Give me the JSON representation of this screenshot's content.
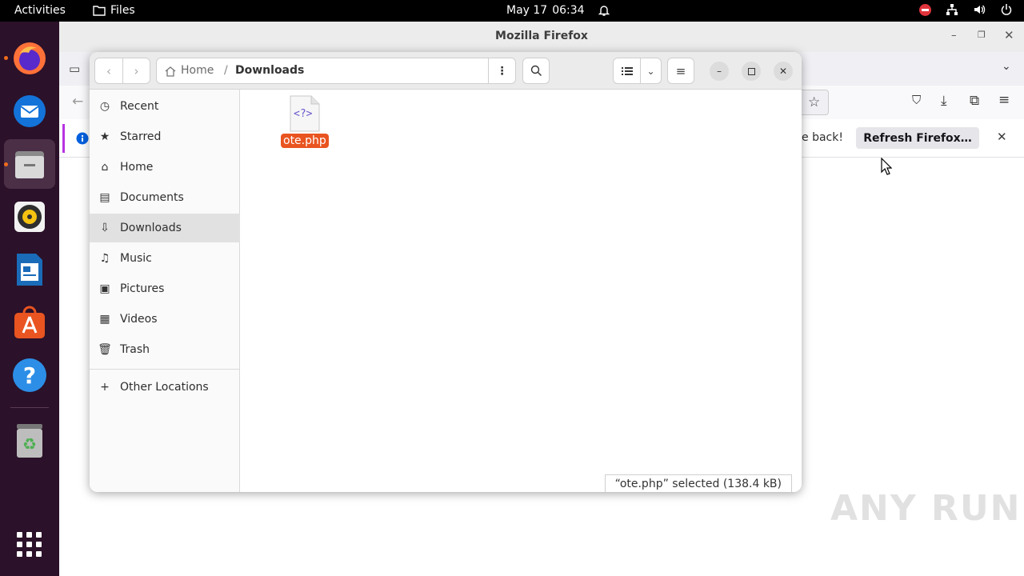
{
  "topbar": {
    "activities": "Activities",
    "app_name": "Files",
    "date": "May 17",
    "time": "06:34"
  },
  "dock": {
    "apps": [
      "firefox-icon",
      "thunderbird-icon",
      "files-icon",
      "rhythmbox-icon",
      "libreoffice-writer-icon",
      "app-center-icon",
      "help-icon",
      "trash-icon",
      "show-apps-icon"
    ]
  },
  "firefox": {
    "title": "Mozilla Firefox",
    "notice_text": "e back!",
    "refresh_button": "Refresh Firefox…"
  },
  "files": {
    "path_home": "Home",
    "path_separator": "/",
    "path_current": "Downloads",
    "sidebar": [
      {
        "label": "Recent",
        "icon": "clock-icon",
        "glyph": "◷"
      },
      {
        "label": "Starred",
        "icon": "star-icon",
        "glyph": "★"
      },
      {
        "label": "Home",
        "icon": "home-icon",
        "glyph": "⌂"
      },
      {
        "label": "Documents",
        "icon": "document-icon",
        "glyph": "▤"
      },
      {
        "label": "Downloads",
        "icon": "download-icon",
        "glyph": "⇩"
      },
      {
        "label": "Music",
        "icon": "music-icon",
        "glyph": "♫"
      },
      {
        "label": "Pictures",
        "icon": "pictures-icon",
        "glyph": "▣"
      },
      {
        "label": "Videos",
        "icon": "videos-icon",
        "glyph": "▦"
      },
      {
        "label": "Trash",
        "icon": "trash-icon",
        "glyph": "🗑"
      }
    ],
    "other_locations": "Other Locations",
    "file": {
      "icon_text": "<?>",
      "name": "ote.php"
    },
    "status": "“ote.php” selected  (138.4 kB)"
  },
  "watermark": "ANY RUN",
  "colors": {
    "selection": "#e95420",
    "dock_bg": "#2b1129"
  }
}
